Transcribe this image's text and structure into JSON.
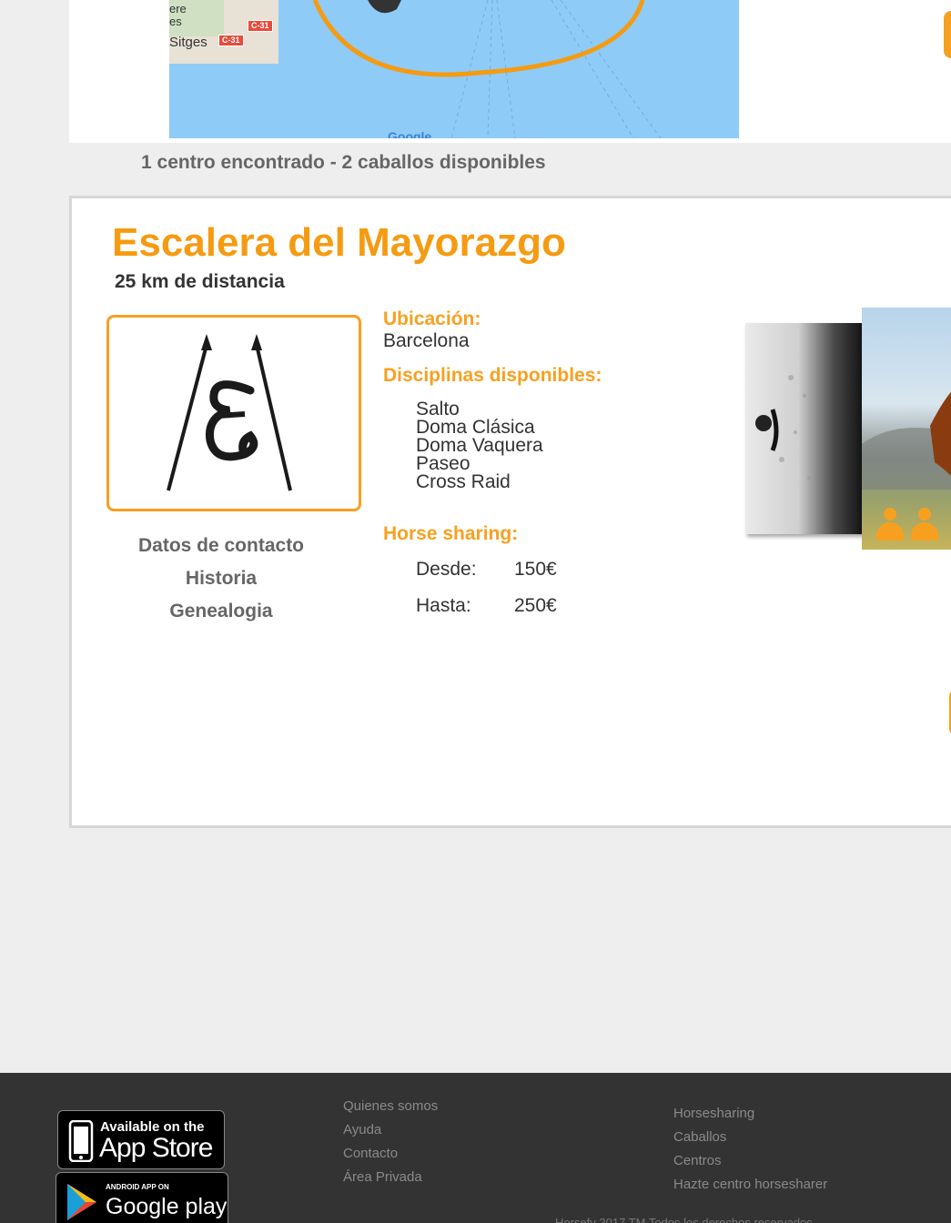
{
  "map": {
    "labels": [
      "ere",
      "es",
      "Sitges"
    ],
    "road_labels": [
      "C-31",
      "C-31"
    ],
    "attribution": "Google"
  },
  "results": {
    "summary": "1 centro encontrado - 2 caballos disponibles"
  },
  "center": {
    "name": "Escalera del Mayorazgo",
    "distance": "25 km de distancia",
    "logo_icon": "center-logo",
    "links": [
      "Datos de contacto",
      "Historia",
      "Genealogia"
    ],
    "location_label": "Ubicación:",
    "location": "Barcelona",
    "disciplines_label": "Disciplinas disponibles:",
    "disciplines": [
      "Salto",
      "Doma Clásica",
      "Doma Vaquera",
      "Paseo",
      "Cross Raid"
    ],
    "sharing_label": "Horse sharing:",
    "price_from_label": "Desde:",
    "price_from": "150€",
    "price_to_label": "Hasta:",
    "price_to": "250€",
    "horse_photos": [
      "horse-photo-white",
      "horse-photo-brown"
    ],
    "shared_icon": "users-icon"
  },
  "footer": {
    "appstore_small": "Available on the",
    "appstore_big": "App Store",
    "gplay_small": "ANDROID APP ON",
    "gplay_big": "Google play",
    "col1": [
      "Quienes somos",
      "Ayuda",
      "Contacto",
      "Área Privada"
    ],
    "col2": [
      "Horsesharing",
      "Caballos",
      "Centros",
      "Hazte centro horsesharer"
    ],
    "copyright": "Horsefy 2017 TM Todos los derechos reservados"
  },
  "colors": {
    "accent": "#f7a020",
    "footer_bg": "#333333",
    "page_bg": "#eeeeee"
  }
}
